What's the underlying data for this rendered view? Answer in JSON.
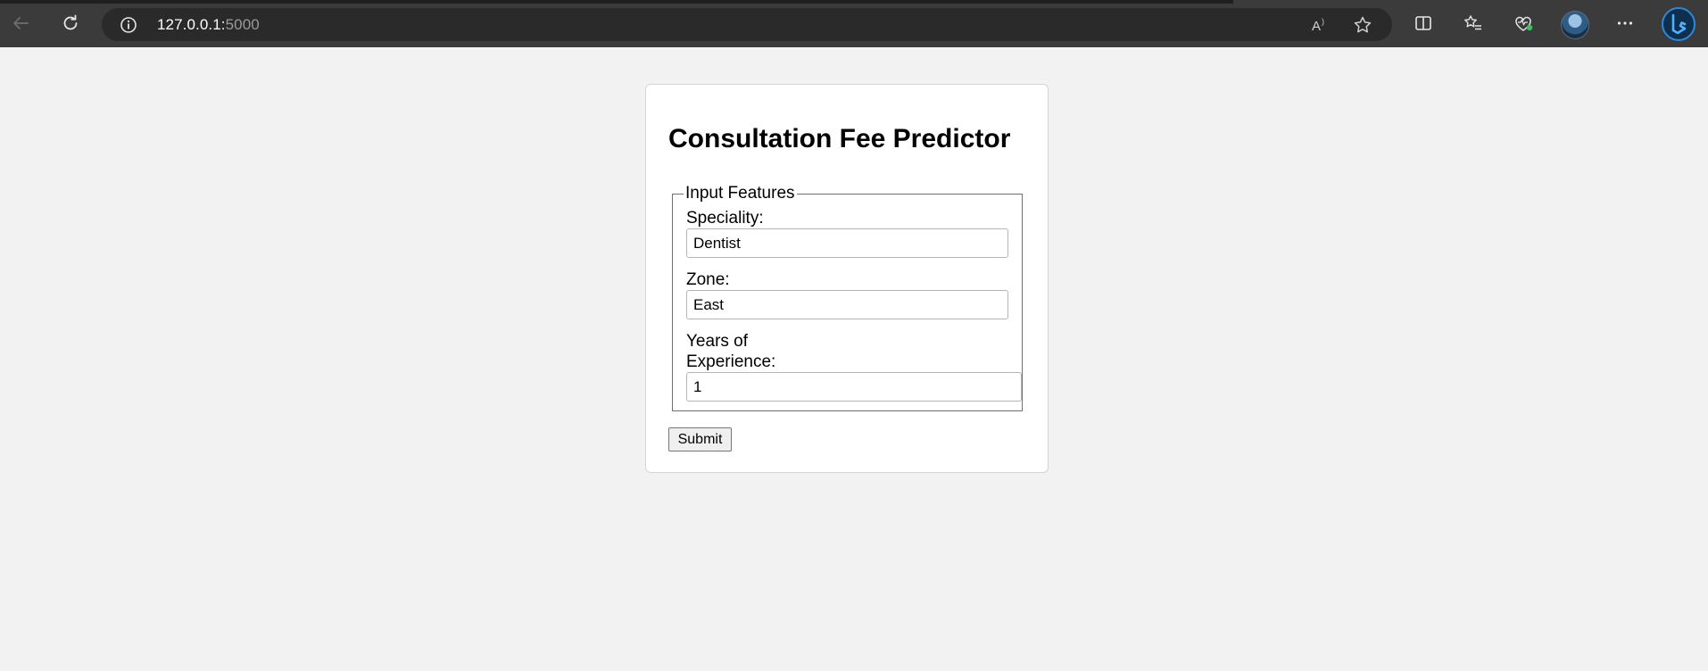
{
  "browser": {
    "url_host": "127.0.0.1:",
    "url_port": "5000"
  },
  "page": {
    "title": "Consultation Fee Predictor",
    "legend": "Input Features",
    "fields": {
      "speciality": {
        "label": "Speciality:",
        "value": "Dentist"
      },
      "zone": {
        "label": "Zone:",
        "value": "East"
      },
      "experience": {
        "label_line1": "Years of",
        "label_line2": "Experience:",
        "value": "1"
      }
    },
    "submit_label": "Submit"
  },
  "colors": {
    "page_bg": "#f2f2f2",
    "chrome_bg": "#3b3b3b",
    "address_bg": "#2a2a2a",
    "card_bg": "#ffffff"
  }
}
